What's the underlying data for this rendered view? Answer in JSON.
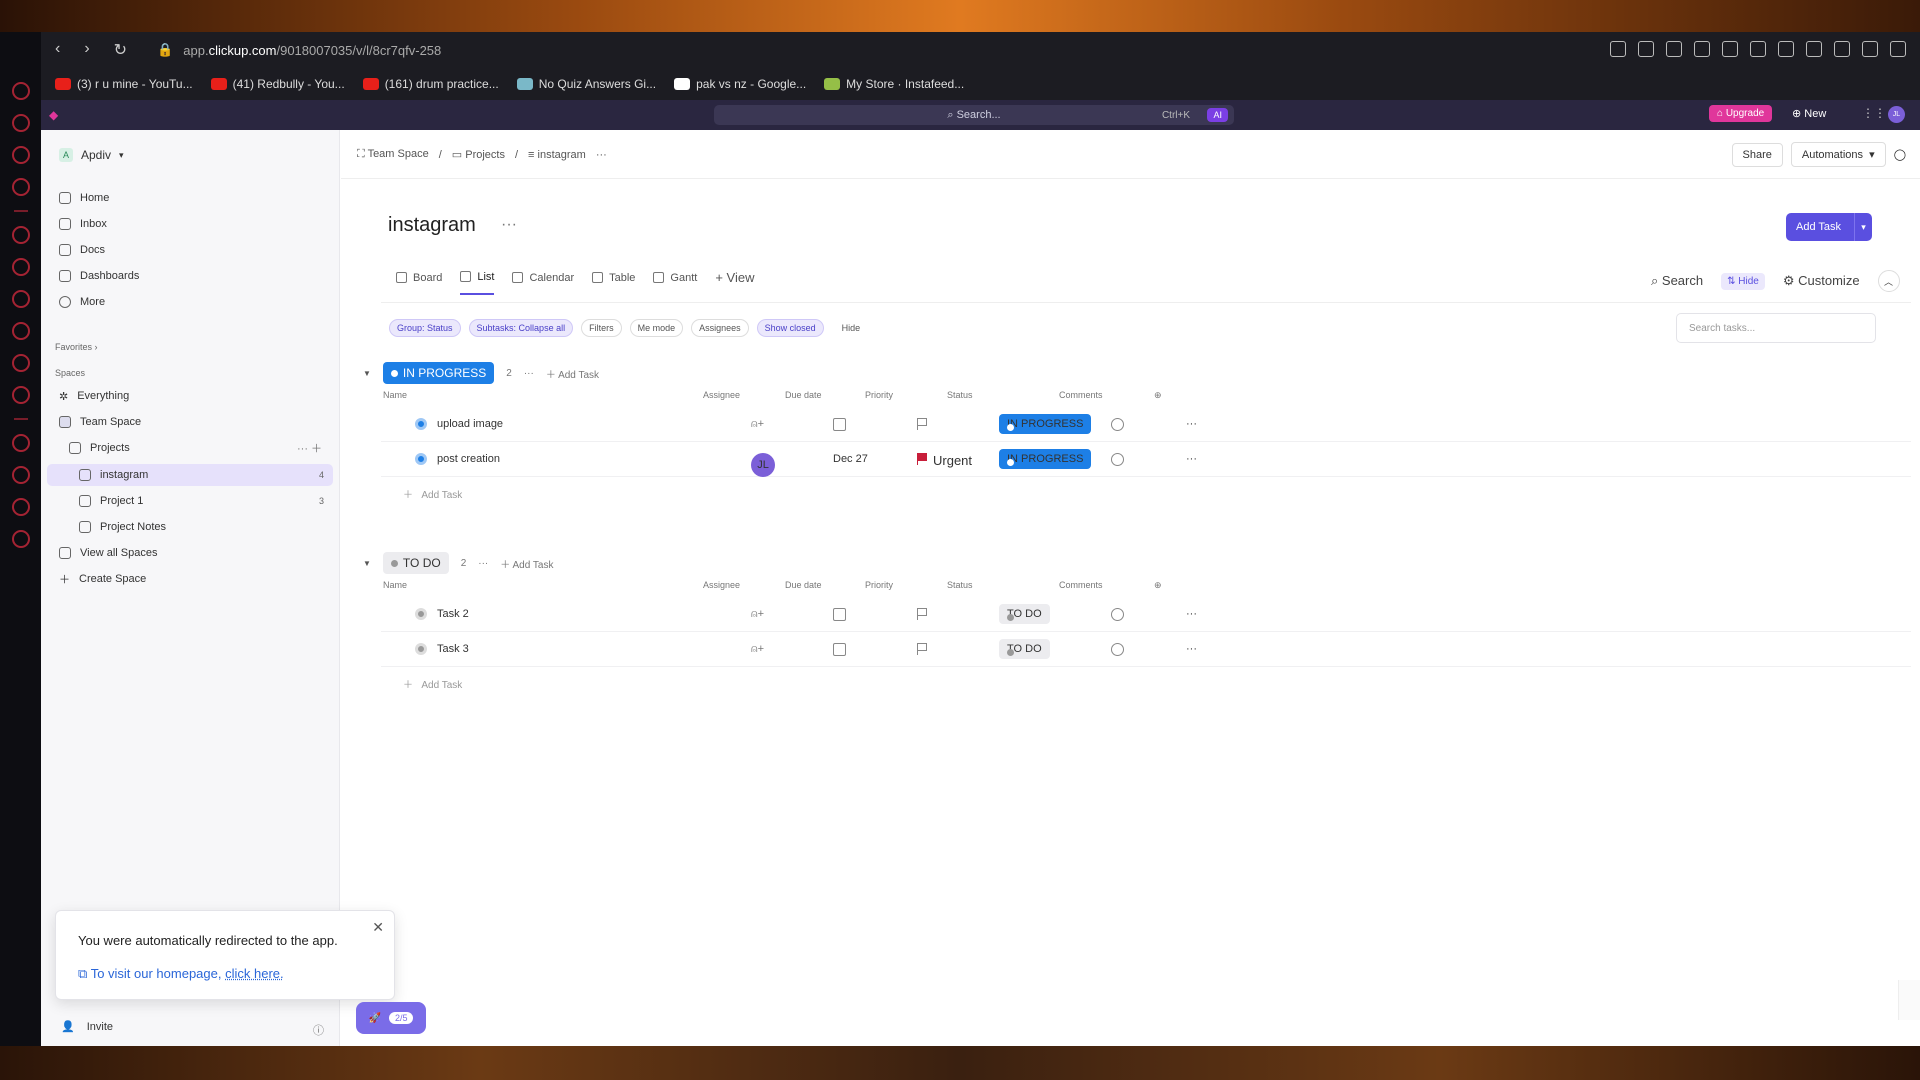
{
  "browser": {
    "url_prefix": "app.",
    "url_domain": "clickup.com",
    "url_path": "/9018007035/v/l/8cr7qfv-258",
    "bookmarks": [
      {
        "label": "(3) r u mine - YouTu...",
        "color": "#e8201a"
      },
      {
        "label": "(41) Redbully - You...",
        "color": "#e8201a"
      },
      {
        "label": "(161) drum practice...",
        "color": "#e8201a"
      },
      {
        "label": "No Quiz Answers Gi...",
        "color": "#7ab8c8"
      },
      {
        "label": "pak vs nz - Google...",
        "color": "#ffffff"
      },
      {
        "label": "My Store · Instafeed...",
        "color": "#95bf47"
      }
    ]
  },
  "appbar": {
    "search_placeholder": "Search...",
    "shortcut": "Ctrl+K",
    "ai_label": "AI",
    "upgrade_label": "Upgrade",
    "new_label": "New",
    "user_initials": "JL"
  },
  "sidebar": {
    "workspace": "Apdiv",
    "workspace_initial": "A",
    "nav": [
      "Home",
      "Inbox",
      "Docs",
      "Dashboards",
      "More"
    ],
    "favorites_label": "Favorites",
    "spaces_label": "Spaces",
    "everything": "Everything",
    "team_space": "Team Space",
    "projects": "Projects",
    "lists": [
      {
        "label": "instagram",
        "count": "4"
      },
      {
        "label": "Project 1",
        "count": "3"
      },
      {
        "label": "Project Notes",
        "count": ""
      }
    ],
    "view_all_spaces": "View all Spaces",
    "create_space": "Create Space",
    "invite": "Invite"
  },
  "toast": {
    "message": "You were automatically redirected to the app.",
    "link_prefix": "To visit our homepage,",
    "link_text": "click here."
  },
  "onboarding": {
    "progress": "2/5"
  },
  "header": {
    "crumbs": [
      "Team Space",
      "Projects",
      "instagram"
    ],
    "share": "Share",
    "automations": "Automations"
  },
  "page": {
    "title": "instagram",
    "add_task": "Add Task"
  },
  "views": {
    "tabs": [
      "Board",
      "List",
      "Calendar",
      "Table",
      "Gantt"
    ],
    "add_view": "+ View",
    "search": "Search",
    "hide": "Hide",
    "customize": "Customize"
  },
  "filters": {
    "chips": [
      "Group: Status",
      "Subtasks: Collapse all",
      "Filters",
      "Me mode",
      "Assignees",
      "Show closed"
    ],
    "hide": "Hide",
    "search_placeholder": "Search tasks..."
  },
  "columns": [
    "Name",
    "Assignee",
    "Due date",
    "Priority",
    "Status",
    "Comments"
  ],
  "groups": [
    {
      "status": "IN PROGRESS",
      "count": "2",
      "add_task": "Add Task",
      "tasks": [
        {
          "name": "upload image",
          "assignee": "",
          "due": "",
          "priority": "",
          "status": "IN PROGRESS"
        },
        {
          "name": "post creation",
          "assignee": "JL",
          "due": "Dec 27",
          "priority": "Urgent",
          "status": "IN PROGRESS"
        }
      ],
      "add_row": "Add Task"
    },
    {
      "status": "TO DO",
      "count": "2",
      "add_task": "Add Task",
      "tasks": [
        {
          "name": "Task 2",
          "assignee": "",
          "due": "",
          "priority": "",
          "status": "TO DO"
        },
        {
          "name": "Task 3",
          "assignee": "",
          "due": "",
          "priority": "",
          "status": "TO DO"
        }
      ],
      "add_row": "Add Task"
    }
  ],
  "colors": {
    "accent": "#5a4fe0",
    "in_progress": "#1d7fe6",
    "urgent": "#c81e3a"
  }
}
